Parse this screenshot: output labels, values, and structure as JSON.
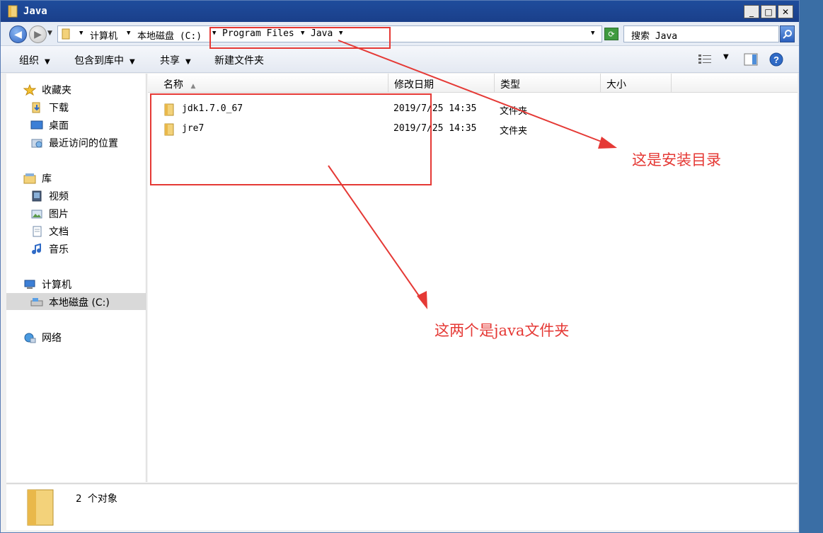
{
  "window": {
    "title": "Java",
    "minimize": "_",
    "maximize": "□",
    "close": "✕"
  },
  "address": {
    "segments": [
      "计算机",
      "本地磁盘 (C:)",
      "Program Files",
      "Java"
    ],
    "search_placeholder": "搜索 Java"
  },
  "toolbar": {
    "organize": "组织",
    "include_library": "包含到库中",
    "share": "共享",
    "new_folder": "新建文件夹"
  },
  "nav": {
    "favorites": "收藏夹",
    "downloads": "下载",
    "desktop": "桌面",
    "recent": "最近访问的位置",
    "libraries": "库",
    "videos": "视频",
    "pictures": "图片",
    "documents": "文档",
    "music": "音乐",
    "computer": "计算机",
    "local_disk": "本地磁盘 (C:)",
    "network": "网络"
  },
  "columns": {
    "name": "名称",
    "modified": "修改日期",
    "type": "类型",
    "size": "大小"
  },
  "files": [
    {
      "name": "jdk1.7.0_67",
      "modified": "2019/7/25 14:35",
      "type": "文件夹"
    },
    {
      "name": "jre7",
      "modified": "2019/7/25 14:35",
      "type": "文件夹"
    }
  ],
  "status": {
    "count": "2 个对象"
  },
  "annotations": {
    "install_dir": "这是安装目录",
    "java_folders": "这两个是java文件夹",
    "color": "#e53935"
  }
}
